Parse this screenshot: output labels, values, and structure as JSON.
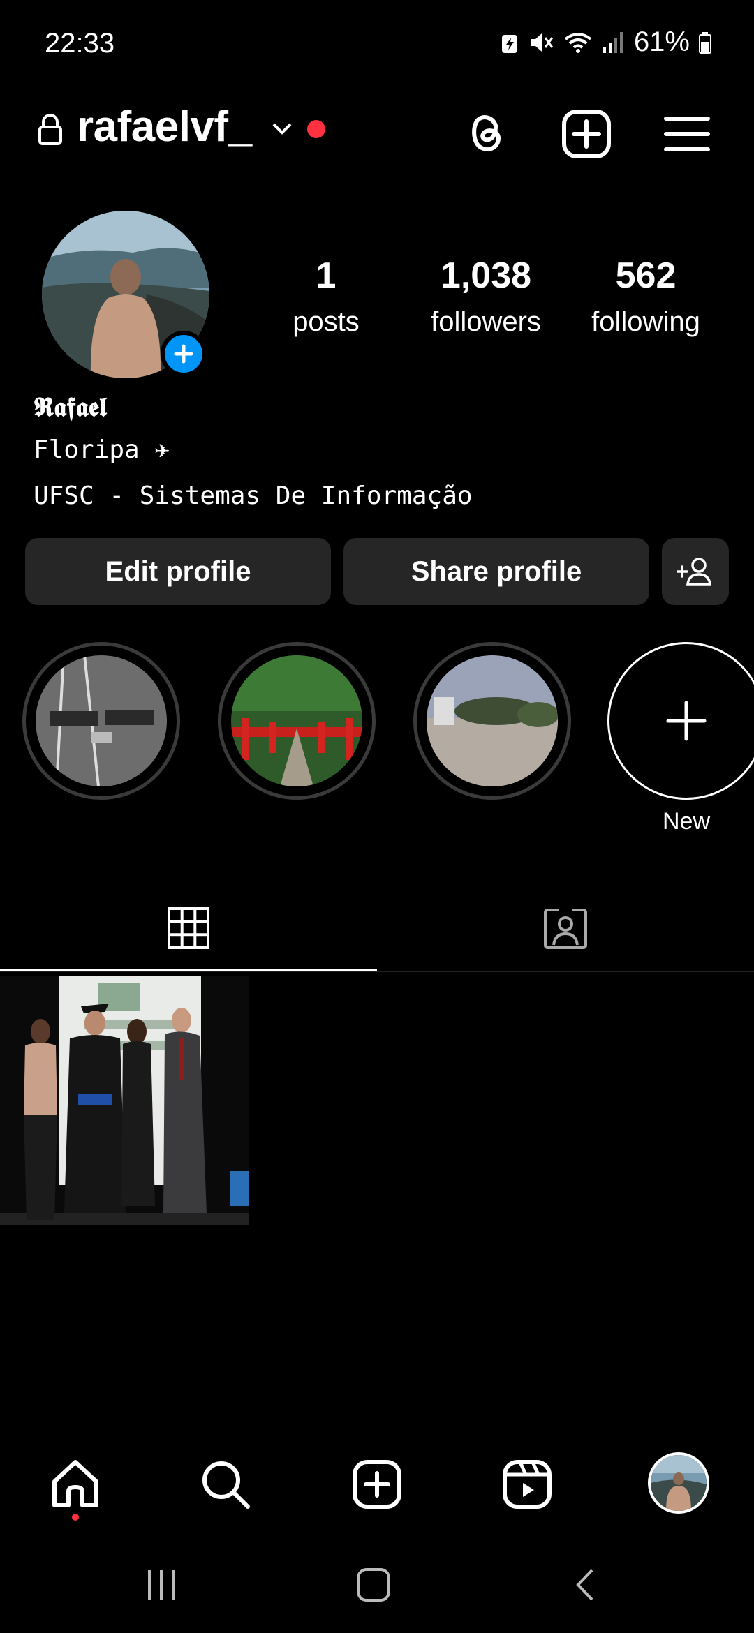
{
  "status_bar": {
    "time": "22:33",
    "battery": "61%"
  },
  "header": {
    "username": "rafaelvf_"
  },
  "profile": {
    "display_name": "𝕽𝖆𝖋𝖆𝖊𝖑",
    "bio_line1": "Floripa ✈",
    "bio_line2": "UFSC - Sistemas De Informação",
    "stats": {
      "posts": {
        "count": "1",
        "label": "posts"
      },
      "followers": {
        "count": "1,038",
        "label": "followers"
      },
      "following": {
        "count": "562",
        "label": "following"
      }
    }
  },
  "actions": {
    "edit_label": "Edit profile",
    "share_label": "Share profile"
  },
  "highlights": {
    "new_label": "New"
  },
  "colors": {
    "accent_blue": "#0095f6",
    "notification_red": "#ff3040",
    "button_bg": "#262626"
  }
}
